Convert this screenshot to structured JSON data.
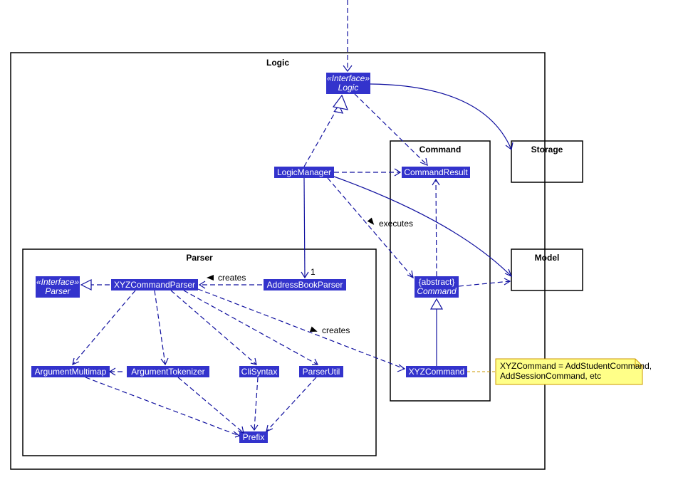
{
  "packages": {
    "logic": "Logic",
    "parser": "Parser",
    "command": "Command",
    "storage": "Storage",
    "model": "Model"
  },
  "classes": {
    "logic_iface_stereo": "«Interface»",
    "logic_iface_name": "Logic",
    "logic_manager": "LogicManager",
    "command_result": "CommandResult",
    "command_abs_stereo": "{abstract}",
    "command_abs_name": "Command",
    "xyz_command": "XYZCommand",
    "addressbook_parser": "AddressBookParser",
    "xyz_command_parser": "XYZCommandParser",
    "parser_iface_stereo": "«Interface»",
    "parser_iface_name": "Parser",
    "argument_multimap": "ArgumentMultimap",
    "argument_tokenizer": "ArgumentTokenizer",
    "cli_syntax": "CliSyntax",
    "parser_util": "ParserUtil",
    "prefix": "Prefix"
  },
  "edges": {
    "creates1": "creates",
    "creates2": "creates",
    "executes": "executes",
    "one": "1"
  },
  "note": {
    "line1": "XYZCommand = AddStudentCommand,",
    "line2": "AddSessionCommand, etc"
  }
}
